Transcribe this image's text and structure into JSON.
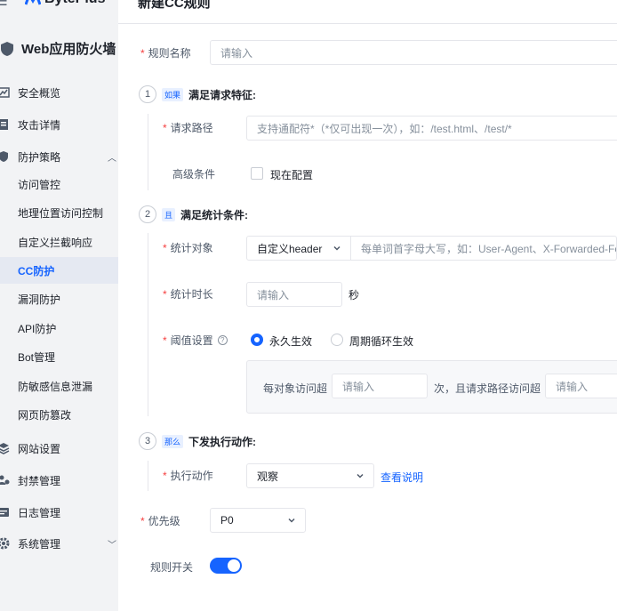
{
  "sidebar": {
    "logo_text": "BytePlus",
    "brand_title": "Web应用防火墙",
    "items": [
      {
        "label": "安全概览",
        "icon": "chart-icon"
      },
      {
        "label": "攻击详情",
        "icon": "document-icon"
      },
      {
        "label": "防护策略",
        "icon": "shield-icon",
        "expanded": true
      }
    ],
    "sub_items": [
      {
        "label": "访问管控"
      },
      {
        "label": "地理位置访问控制"
      },
      {
        "label": "自定义拦截响应"
      },
      {
        "label": "CC防护",
        "active": true
      },
      {
        "label": "漏洞防护"
      },
      {
        "label": "API防护"
      },
      {
        "label": "Bot管理"
      },
      {
        "label": "防敏感信息泄漏"
      },
      {
        "label": "网页防篡改"
      }
    ],
    "bottom_items": [
      {
        "label": "网站设置",
        "icon": "layers-icon"
      },
      {
        "label": "封禁管理",
        "icon": "users-icon"
      },
      {
        "label": "日志管理",
        "icon": "log-icon"
      },
      {
        "label": "系统管理",
        "icon": "gear-icon"
      }
    ]
  },
  "page": {
    "title": "新建CC规则"
  },
  "form": {
    "rule_name": {
      "label": "规则名称",
      "placeholder": "请输入"
    },
    "step1": {
      "num": "1",
      "tag": "如果",
      "title": "满足请求特征:"
    },
    "request_path": {
      "label": "请求路径",
      "placeholder": "支持通配符*（*仅可出现一次），如：/test.html、/test/*"
    },
    "advanced": {
      "label": "高级条件",
      "checkbox_label": "现在配置"
    },
    "step2": {
      "num": "2",
      "tag": "且",
      "title": "满足统计条件:"
    },
    "stat_target": {
      "label": "统计对象",
      "select_value": "自定义header",
      "placeholder": "每单词首字母大写，如：User-Agent、X-Forwarded-For,"
    },
    "stat_duration": {
      "label": "统计时长",
      "placeholder": "请输入",
      "unit": "秒"
    },
    "threshold": {
      "label": "阈值设置",
      "option_permanent": "永久生效",
      "option_periodic": "周期循环生效",
      "selected": "永久生效",
      "per_object_label": "每对象访问超",
      "per_object_placeholder": "请输入",
      "and_path_label": "次，且请求路径访问超",
      "path_placeholder": "请输入"
    },
    "step3": {
      "num": "3",
      "tag": "那么",
      "title": "下发执行动作:"
    },
    "action": {
      "label": "执行动作",
      "select_value": "观察",
      "link": "查看说明"
    },
    "priority": {
      "label": "优先级",
      "select_value": "P0"
    },
    "switch": {
      "label": "规则开关",
      "on": true
    }
  },
  "colors": {
    "accent": "#1664ff",
    "required": "#f53f3f",
    "sidebar_bg": "#f2f3f5"
  }
}
